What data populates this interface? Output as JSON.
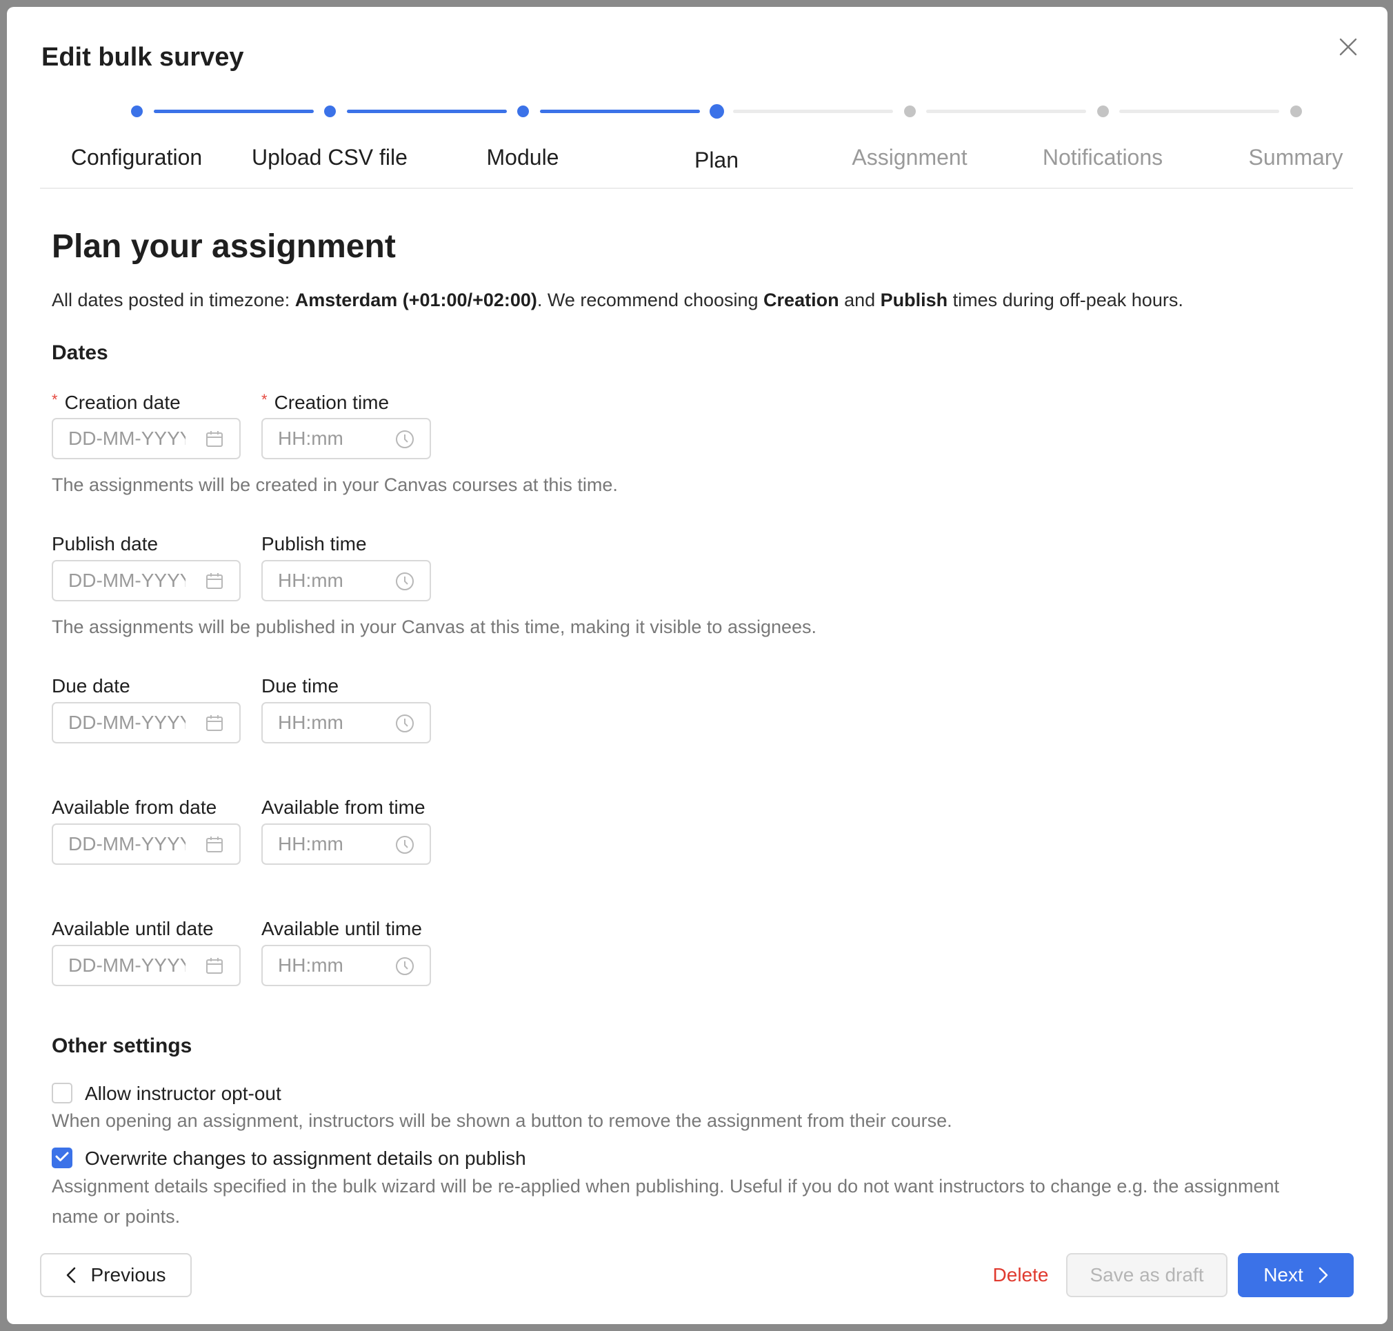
{
  "modal": {
    "title": "Edit bulk survey"
  },
  "stepper": {
    "steps": [
      {
        "label": "Configuration",
        "state": "done"
      },
      {
        "label": "Upload CSV file",
        "state": "done"
      },
      {
        "label": "Module",
        "state": "done"
      },
      {
        "label": "Plan",
        "state": "current"
      },
      {
        "label": "Assignment",
        "state": "todo"
      },
      {
        "label": "Notifications",
        "state": "todo"
      },
      {
        "label": "Summary",
        "state": "todo"
      }
    ]
  },
  "main": {
    "heading": "Plan your assignment",
    "intro": {
      "part1": "All dates posted in timezone: ",
      "timezone": "Amsterdam (+01:00/+02:00)",
      "part2": ". We recommend choosing ",
      "creation": "Creation",
      "part3": " and ",
      "publish": "Publish",
      "part4": " times during off-peak hours."
    },
    "dates_title": "Dates",
    "required_mark": "*",
    "fields": {
      "creation": {
        "date_label": "Creation date",
        "time_label": "Creation time",
        "date_placeholder": "DD-MM-YYYY",
        "time_placeholder": "HH:mm",
        "help": "The assignments will be created in your Canvas courses at this time."
      },
      "publish": {
        "date_label": "Publish date",
        "time_label": "Publish time",
        "date_placeholder": "DD-MM-YYYY",
        "time_placeholder": "HH:mm",
        "help": "The assignments will be published in your Canvas at this time, making it visible to assignees."
      },
      "due": {
        "date_label": "Due date",
        "time_label": "Due time",
        "date_placeholder": "DD-MM-YYYY",
        "time_placeholder": "HH:mm"
      },
      "available_from": {
        "date_label": "Available from date",
        "time_label": "Available from time",
        "date_placeholder": "DD-MM-YYYY",
        "time_placeholder": "HH:mm"
      },
      "available_until": {
        "date_label": "Available until date",
        "time_label": "Available until time",
        "date_placeholder": "DD-MM-YYYY",
        "time_placeholder": "HH:mm"
      }
    },
    "other_title": "Other settings",
    "opt_out": {
      "label": "Allow instructor opt-out",
      "checked": false,
      "help": "When opening an assignment, instructors will be shown a button to remove the assignment from their course."
    },
    "overwrite": {
      "label": "Overwrite changes to assignment details on publish",
      "checked": true,
      "help": "Assignment details specified in the bulk wizard will be re-applied when publishing. Useful if you do not want instructors to change e.g. the assignment name or points."
    }
  },
  "footer": {
    "previous_label": "Previous",
    "delete_label": "Delete",
    "draft_label": "Save as draft",
    "next_label": "Next"
  },
  "colors": {
    "accent": "#3b72e8",
    "danger": "#e03a2f",
    "required": "#e5483f"
  },
  "icons": {
    "close": "close-icon",
    "date": "calendar-icon",
    "time": "clock-icon",
    "previous": "chevron-left-icon",
    "next": "chevron-right-icon",
    "check": "checkmark-icon"
  }
}
